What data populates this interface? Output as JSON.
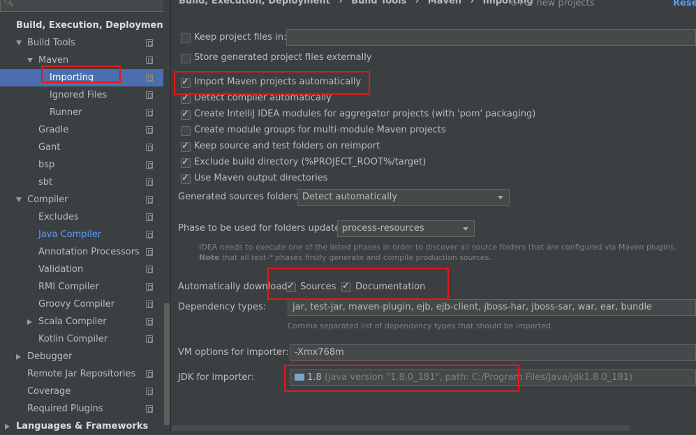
{
  "search": {
    "placeholder": ""
  },
  "breadcrumb": {
    "items": [
      "Build, Execution, Deployment",
      "Build Tools",
      "Maven",
      "Importing"
    ],
    "separator": "›",
    "scope_hint": "For new projects",
    "reset_label": "Reset"
  },
  "sidebar": {
    "items": [
      {
        "label": "Build, Execution, Deployment",
        "level": 0,
        "bold": true,
        "arrow": "none",
        "copy": false
      },
      {
        "label": "Build Tools",
        "level": 1,
        "arrow": "down",
        "copy": true
      },
      {
        "label": "Maven",
        "level": 2,
        "arrow": "down",
        "copy": true
      },
      {
        "label": "Importing",
        "level": 3,
        "selected": true,
        "copy": true
      },
      {
        "label": "Ignored Files",
        "level": 3,
        "copy": true
      },
      {
        "label": "Runner",
        "level": 3,
        "copy": true
      },
      {
        "label": "Gradle",
        "level": 2,
        "copy": true
      },
      {
        "label": "Gant",
        "level": 2,
        "copy": true
      },
      {
        "label": "bsp",
        "level": 2,
        "copy": true
      },
      {
        "label": "sbt",
        "level": 2,
        "copy": true
      },
      {
        "label": "Compiler",
        "level": 1,
        "arrow": "down",
        "copy": true
      },
      {
        "label": "Excludes",
        "level": 2,
        "copy": true
      },
      {
        "label": "Java Compiler",
        "level": 2,
        "link": true,
        "copy": true
      },
      {
        "label": "Annotation Processors",
        "level": 2,
        "copy": true
      },
      {
        "label": "Validation",
        "level": 2,
        "copy": true
      },
      {
        "label": "RMI Compiler",
        "level": 2,
        "copy": true
      },
      {
        "label": "Groovy Compiler",
        "level": 2,
        "copy": true
      },
      {
        "label": "Scala Compiler",
        "level": 2,
        "arrow": "right",
        "copy": true
      },
      {
        "label": "Kotlin Compiler",
        "level": 2,
        "copy": true
      },
      {
        "label": "Debugger",
        "level": 1,
        "arrow": "right",
        "copy": false
      },
      {
        "label": "Remote Jar Repositories",
        "level": 1,
        "copy": true
      },
      {
        "label": "Coverage",
        "level": 1,
        "copy": true
      },
      {
        "label": "Required Plugins",
        "level": 1,
        "copy": true
      },
      {
        "label": "Languages & Frameworks",
        "level": 0,
        "bold": true,
        "arrow": "right",
        "copy": false
      }
    ]
  },
  "options": {
    "keep_project_files": {
      "label": "Keep project files in:",
      "checked": false,
      "value": ""
    },
    "store_externally": {
      "label": "Store generated project files externally",
      "checked": false
    },
    "checkboxes": [
      {
        "label": "Import Maven projects automatically",
        "checked": true
      },
      {
        "label": "Detect compiler automatically",
        "checked": true
      },
      {
        "label": "Create IntelliJ IDEA modules for aggregator projects (with 'pom' packaging)",
        "checked": true
      },
      {
        "label": "Create module groups for multi-module Maven projects",
        "checked": false
      },
      {
        "label": "Keep source and test folders on reimport",
        "checked": true
      },
      {
        "label": "Exclude build directory (%PROJECT_ROOT%/target)",
        "checked": true
      },
      {
        "label": "Use Maven output directories",
        "checked": true
      }
    ],
    "generated_sources": {
      "label": "Generated sources folders:",
      "value": "Detect automatically"
    },
    "phase": {
      "label": "Phase to be used for folders update:",
      "value": "process-resources",
      "hint_line1": "IDEA needs to execute one of the listed phases in order to discover all source folders that are configured via Maven plugins.",
      "hint_note_bold": "Note",
      "hint_line2": " that all test-* phases firstly generate and compile production sources."
    },
    "auto_download": {
      "label": "Automatically download:",
      "sources": {
        "label": "Sources",
        "checked": true
      },
      "documentation": {
        "label": "Documentation",
        "checked": true
      }
    },
    "dependency_types": {
      "label": "Dependency types:",
      "value": "jar, test-jar, maven-plugin, ejb, ejb-client, jboss-har, jboss-sar, war, ear, bundle",
      "hint": "Comma separated list of dependency types that should be imported"
    },
    "vm_options": {
      "label": "VM options for importer:",
      "value": "-Xmx768m"
    },
    "jdk": {
      "label": "JDK for importer:",
      "version": "1.8",
      "detail": "(java version \"1.8.0_181\", path: C:/Program Files/Java/jdk1.8.0_181)",
      "icon": "folder-icon"
    }
  },
  "colors": {
    "background": "#3c3f41",
    "selection": "#4b6eaf",
    "link": "#589df6",
    "highlight_box": "#e11a1a"
  }
}
